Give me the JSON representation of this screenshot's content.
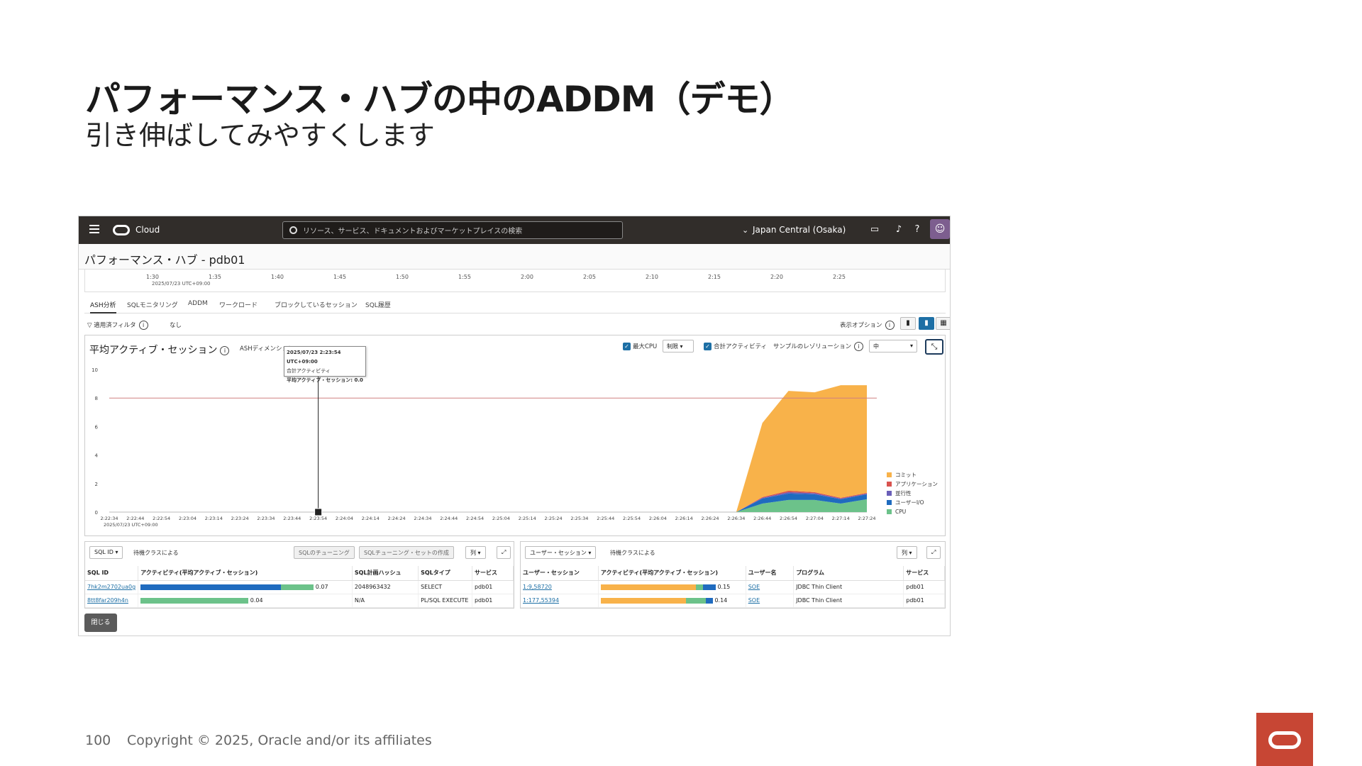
{
  "slide": {
    "title": "パフォーマンス・ハブの中のADDM（デモ）",
    "subtitle": "引き伸ばしてみやすくします",
    "page_number": "100",
    "copyright": "Copyright © 2025, Oracle and/or its affiliates"
  },
  "topbar": {
    "brand": "Cloud",
    "search_placeholder": "リソース、サービス、ドキュメントおよびマーケットプレイスの検索",
    "region": "Japan Central (Osaka)"
  },
  "page": {
    "title": "パフォーマンス・ハブ - pdb01"
  },
  "overview": {
    "ticks": [
      "1:30",
      "1:35",
      "1:40",
      "1:45",
      "1:50",
      "1:55",
      "2:00",
      "2:05",
      "2:10",
      "2:15",
      "2:20",
      "2:25"
    ],
    "date": "2025/07/23 UTC+09:00"
  },
  "tabs": [
    "ASH分析",
    "SQLモニタリング",
    "ADDM",
    "ワークロード",
    "ブロックしているセッション",
    "SQL履歴"
  ],
  "filter": {
    "label": "適用済フィルタ",
    "value": "なし",
    "view_options": "表示オプション"
  },
  "chart_panel": {
    "title": "平均アクティブ・セッション",
    "ash_dimension": "ASHディメンション",
    "max_cpu": "最大CPU",
    "max_cpu_select": "制限",
    "total_activity": "合計アクティビティ",
    "resolution": "サンプルのレゾリューション",
    "resolution_select": "中",
    "tooltip": {
      "time": "2025/07/23 2:23:54 UTC+09:00",
      "line2": "合計アクティビティ",
      "line3": "平均アクティブ・セッション: 0.0"
    }
  },
  "chart_data": {
    "type": "area",
    "title": "平均アクティブ・セッション",
    "x": [
      "2:22:34",
      "2:22:44",
      "2:22:54",
      "2:23:04",
      "2:23:14",
      "2:23:24",
      "2:23:34",
      "2:23:44",
      "2:23:54",
      "2:24:04",
      "2:24:14",
      "2:24:24",
      "2:24:34",
      "2:24:44",
      "2:24:54",
      "2:25:04",
      "2:25:14",
      "2:25:24",
      "2:25:34",
      "2:25:44",
      "2:25:54",
      "2:26:04",
      "2:26:14",
      "2:26:24",
      "2:26:34",
      "2:26:44",
      "2:26:54",
      "2:27:04",
      "2:27:14",
      "2:27:24"
    ],
    "x_date": "2025/07/23 UTC+09:00",
    "ylim": [
      0,
      10
    ],
    "yticks": [
      0,
      2,
      4,
      6,
      8,
      10
    ],
    "max_cpu_line": 8,
    "series": [
      {
        "name": "CPU",
        "color": "#6cc28a",
        "values": [
          0,
          0,
          0,
          0,
          0,
          0,
          0,
          0,
          0,
          0,
          0,
          0,
          0,
          0,
          0,
          0,
          0,
          0,
          0,
          0,
          0,
          0,
          0,
          0,
          0,
          0.6,
          0.85,
          0.85,
          0.6,
          0.9
        ]
      },
      {
        "name": "ユーザーI/O",
        "color": "#1f6bbf",
        "values": [
          0,
          0,
          0,
          0,
          0,
          0,
          0,
          0,
          0,
          0,
          0,
          0,
          0,
          0,
          0,
          0,
          0,
          0,
          0,
          0,
          0,
          0,
          0,
          0,
          0,
          0.35,
          0.45,
          0.4,
          0.3,
          0.35
        ]
      },
      {
        "name": "並行性",
        "color": "#6a5fb8",
        "values": [
          0,
          0,
          0,
          0,
          0,
          0,
          0,
          0,
          0,
          0,
          0,
          0,
          0,
          0,
          0,
          0,
          0,
          0,
          0,
          0,
          0,
          0,
          0,
          0,
          0,
          0.05,
          0.1,
          0.08,
          0.05,
          0.05
        ]
      },
      {
        "name": "アプリケーション",
        "color": "#d9534f",
        "values": [
          0,
          0,
          0,
          0,
          0,
          0,
          0,
          0,
          0,
          0,
          0,
          0,
          0,
          0,
          0,
          0,
          0,
          0,
          0,
          0,
          0,
          0,
          0,
          0,
          0,
          0.05,
          0.1,
          0.07,
          0.05,
          0.05
        ]
      },
      {
        "name": "コミット",
        "color": "#f8b24a",
        "values": [
          0,
          0,
          0,
          0,
          0,
          0,
          0,
          0,
          0,
          0,
          0,
          0,
          0,
          0,
          0,
          0,
          0,
          0,
          0,
          0,
          0,
          0,
          0,
          0,
          0,
          5.2,
          7.0,
          7.0,
          7.9,
          7.55
        ]
      }
    ],
    "legend_order": [
      "コミット",
      "アプリケーション",
      "並行性",
      "ユーザーI/O",
      "CPU"
    ]
  },
  "sql_grid": {
    "select_label": "SQL ID",
    "by_class": "待機クラスによる",
    "tuning_btn": "SQLのチューニング",
    "tuning_set_btn": "SQLチューニング・セットの作成",
    "columns_btn": "列",
    "headers": [
      "SQL ID",
      "アクティビティ(平均アクティブ・セッション)",
      "SQL計画ハッシュ",
      "SQLタイプ",
      "サービス"
    ],
    "rows": [
      {
        "sql_id": "7hk2m2702ua0g",
        "value": "0.07",
        "plan_hash": "2048963432",
        "type": "SELECT",
        "service": "pdb01"
      },
      {
        "sql_id": "8tt8far209h4n",
        "value": "0.04",
        "plan_hash": "N/A",
        "type": "PL/SQL EXECUTE",
        "service": "pdb01"
      }
    ]
  },
  "session_grid": {
    "select_label": "ユーザー・セッション",
    "by_class": "待機クラスによる",
    "columns_btn": "列",
    "headers": [
      "ユーザー・セッション",
      "アクティビティ(平均アクティブ・セッション)",
      "ユーザー名",
      "プログラム",
      "サービス"
    ],
    "rows": [
      {
        "session": "1:9,58720",
        "value": "0.15",
        "user": "SOE",
        "program": "JDBC Thin Client",
        "service": "pdb01"
      },
      {
        "session": "1:177,55394",
        "value": "0.14",
        "user": "SOE",
        "program": "JDBC Thin Client",
        "service": "pdb01"
      }
    ]
  },
  "close_label": "閉じる",
  "colors": {
    "oracle_red": "#c74634",
    "topbar": "#312d2a",
    "accent_blue": "#1d6fa5"
  }
}
